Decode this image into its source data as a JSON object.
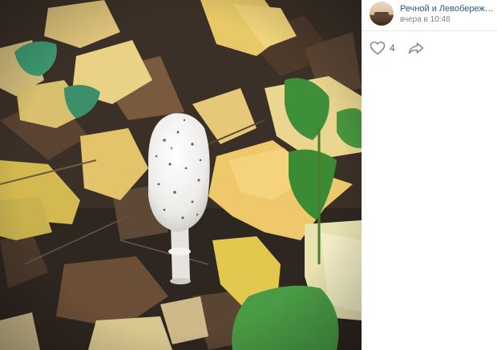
{
  "post": {
    "author_name": "Речной и Левобережный",
    "time": "вчера в 10:48",
    "likes": "4"
  },
  "photo": {
    "subject": "white shaggy mushroom among yellow fallen leaves"
  },
  "colors": {
    "link": "#2a5885",
    "meta": "#828282",
    "icon": "#818c99",
    "divider": "#e7e8ec"
  },
  "icons": {
    "like": "heart-outline",
    "share": "share-arrow"
  }
}
